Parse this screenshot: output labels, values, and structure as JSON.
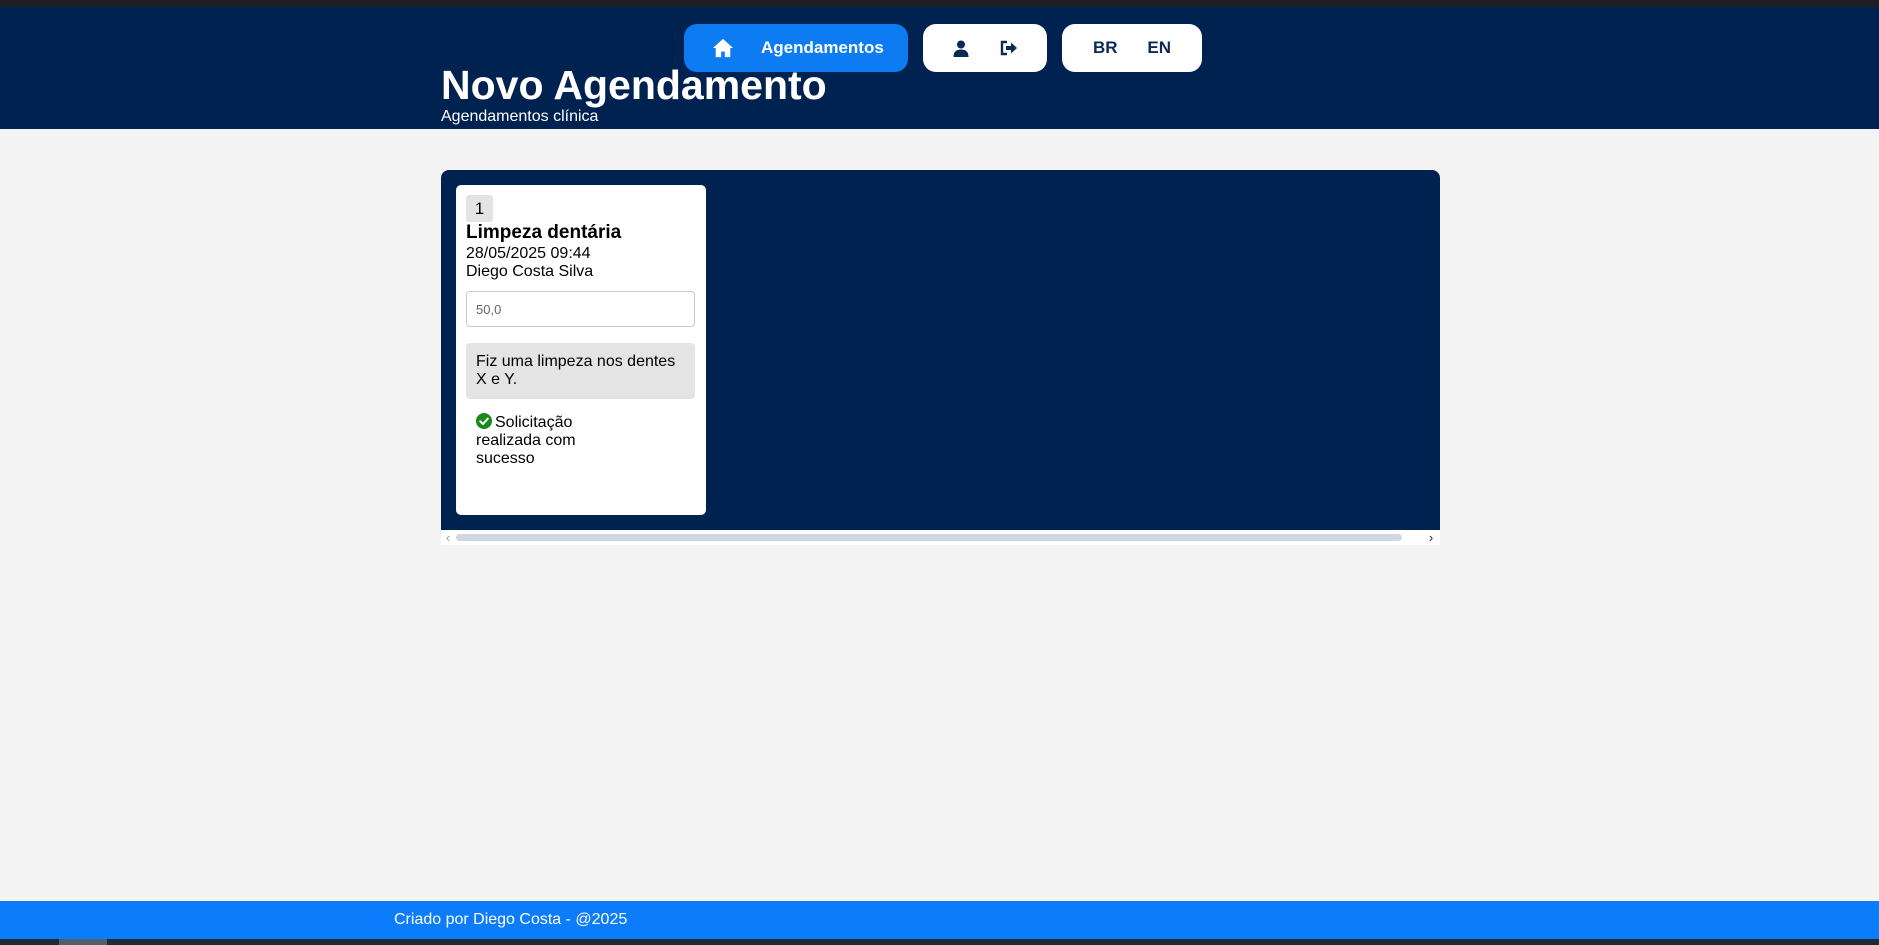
{
  "nav": {
    "home_label": "Agendamentos",
    "home_icon": "home-icon",
    "user_icon": "user-icon",
    "logout_icon": "logout-icon",
    "languages": [
      "BR",
      "EN"
    ],
    "accent": "#0d7cf2"
  },
  "header": {
    "title": "Novo Agendamento",
    "subtitle": "Agendamentos clínica",
    "background": "#002250"
  },
  "appointments": [
    {
      "number": "1",
      "service": "Limpeza dentária",
      "datetime": "28/05/2025 09:44",
      "patient": "Diego Costa Silva",
      "price_placeholder": "50,0",
      "note": "Fiz uma limpeza nos dentes X e Y.",
      "status": "Solicitação realizada com sucesso",
      "status_icon": "check-circle-icon",
      "status_color": "#1a8a1a"
    }
  ],
  "footer": {
    "text": "Criado por Diego Costa - @2025",
    "background": "#0b7cfc"
  }
}
